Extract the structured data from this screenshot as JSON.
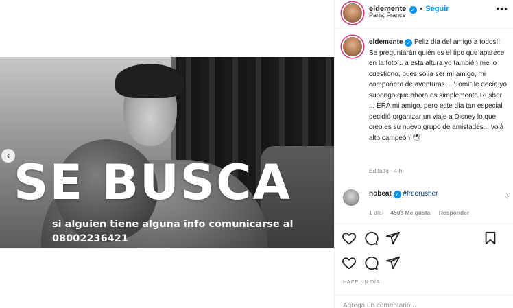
{
  "post": {
    "headline": "SE BUSCA",
    "subtext": "si alguien tiene alguna info comunicarse al 08002236421"
  },
  "header": {
    "username": "eldemente",
    "verified_glyph": "✓",
    "separator": "•",
    "follow_label": "Seguir",
    "location": "Paris, France",
    "more_icon": "more-horizontal-icon"
  },
  "caption": {
    "username": "eldemente",
    "text": "Feliz día del amigo a todos!! Se preguntarán quién es el tipo que aparece en la foto... a esta altura yo también me lo cuestiono, pues solía ser mi amigo, mi compañero de aventuras... \"Tomi\" le decía yo, supongo que ahora es simplemente Rusher ... ERA mi amigo, pero este día tan especial decidió organizar un viaje a Disney lo que creo es su nuevo grupo de amistades... volá alto campeón 🕊",
    "meta": "Editado · 4 h"
  },
  "comments": [
    {
      "username": "nobeat",
      "hashtag": "#freerusher",
      "age": "1 día",
      "likes": "4508 Me gusta",
      "reply_label": "Responder"
    }
  ],
  "footer": {
    "time_label": "HACE UN DÍA",
    "add_comment_placeholder": "Agrega un comentario..."
  },
  "colors": {
    "accent": "#0095f6",
    "text": "#262626",
    "muted": "#8e8e8e",
    "border": "#efefef"
  }
}
